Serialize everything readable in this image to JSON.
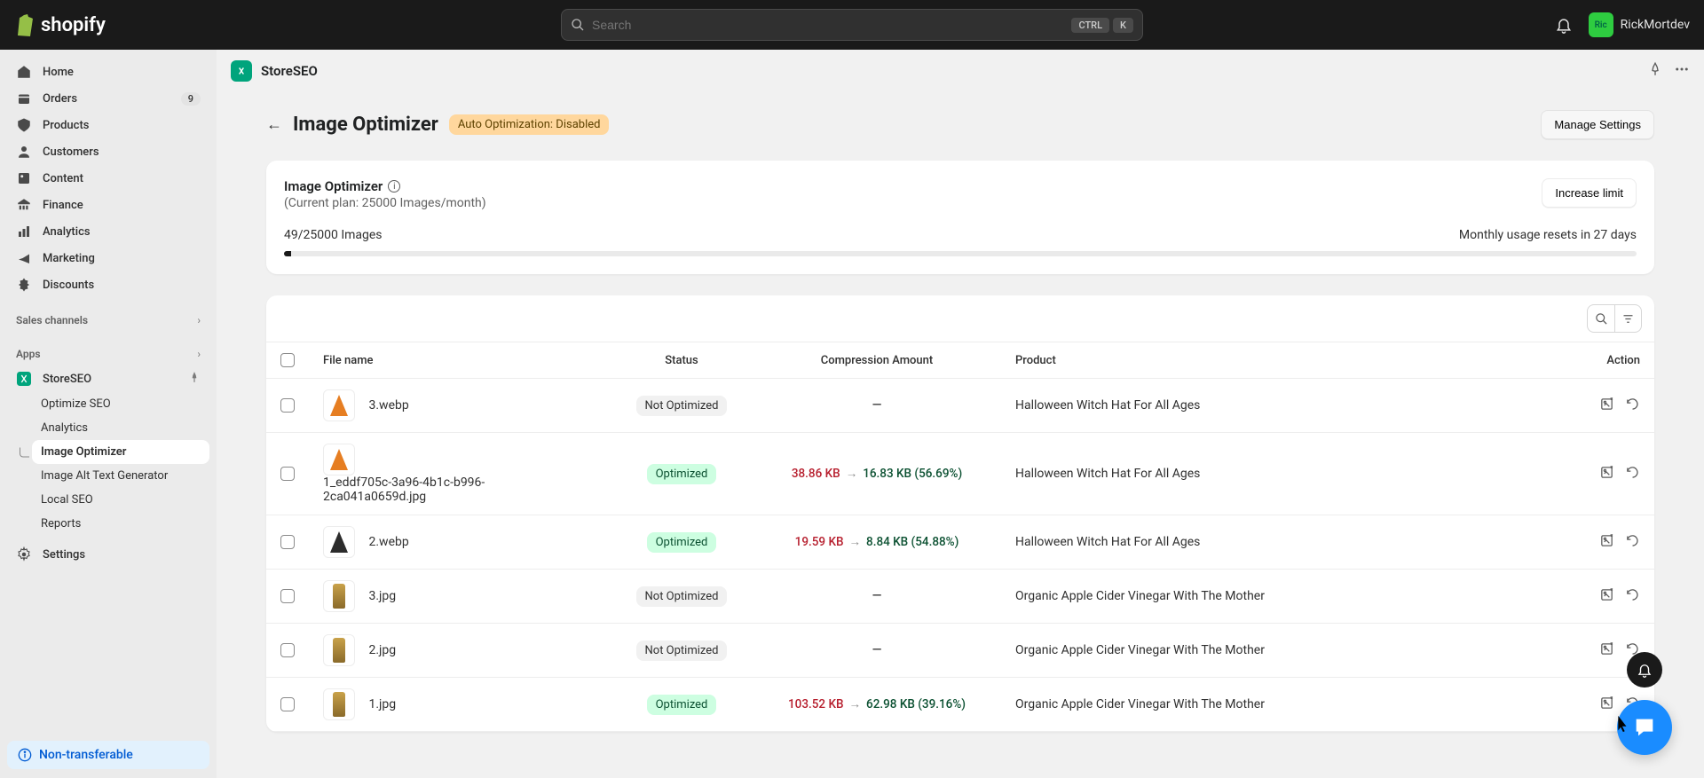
{
  "topbar": {
    "brand": "shopify",
    "search_placeholder": "Search",
    "kbd_ctrl": "CTRL",
    "kbd_k": "K",
    "username": "RickMortdev",
    "avatar_initials": "Ric"
  },
  "sidebar": {
    "items": [
      {
        "label": "Home",
        "icon": "home-icon"
      },
      {
        "label": "Orders",
        "icon": "orders-icon",
        "badge": "9"
      },
      {
        "label": "Products",
        "icon": "products-icon"
      },
      {
        "label": "Customers",
        "icon": "customers-icon"
      },
      {
        "label": "Content",
        "icon": "content-icon"
      },
      {
        "label": "Finance",
        "icon": "finance-icon"
      },
      {
        "label": "Analytics",
        "icon": "analytics-icon"
      },
      {
        "label": "Marketing",
        "icon": "marketing-icon"
      },
      {
        "label": "Discounts",
        "icon": "discounts-icon"
      }
    ],
    "section_sales": "Sales channels",
    "section_apps": "Apps",
    "app_label": "StoreSEO",
    "sub_items": [
      "Optimize SEO",
      "Analytics",
      "Image Optimizer",
      "Image Alt Text Generator",
      "Local SEO",
      "Reports"
    ],
    "settings_label": "Settings",
    "banner_text": "Non-transferable"
  },
  "appbar": {
    "name": "StoreSEO"
  },
  "page": {
    "title": "Image Optimizer",
    "badge": "Auto Optimization: Disabled",
    "manage_btn": "Manage Settings"
  },
  "usage_card": {
    "title": "Image Optimizer",
    "plan": "(Current plan: 25000 Images/month)",
    "increase_btn": "Increase limit",
    "usage_text": "49/25000 Images",
    "reset_text": "Monthly usage resets in 27 days"
  },
  "table": {
    "columns": {
      "filename": "File name",
      "status": "Status",
      "compression": "Compression Amount",
      "product": "Product",
      "action": "Action"
    },
    "status_optimized": "Optimized",
    "status_not_optimized": "Not Optimized",
    "rows": [
      {
        "file": "3.webp",
        "status": "not",
        "from": "",
        "to": "",
        "pct": "",
        "product": "Halloween Witch Hat For All Ages",
        "thumb": "hat-orange"
      },
      {
        "file": "1_eddf705c-3a96-4b1c-b996-2ca041a0659d.jpg",
        "status": "opt",
        "from": "38.86 KB",
        "to": "16.83 KB",
        "pct": "(56.69%)",
        "product": "Halloween Witch Hat For All Ages",
        "thumb": "hat-orange"
      },
      {
        "file": "2.webp",
        "status": "opt",
        "from": "19.59 KB",
        "to": "8.84 KB",
        "pct": "(54.88%)",
        "product": "Halloween Witch Hat For All Ages",
        "thumb": "hat-black"
      },
      {
        "file": "3.jpg",
        "status": "not",
        "from": "",
        "to": "",
        "pct": "",
        "product": "Organic Apple Cider Vinegar With The Mother",
        "thumb": "bottle"
      },
      {
        "file": "2.jpg",
        "status": "not",
        "from": "",
        "to": "",
        "pct": "",
        "product": "Organic Apple Cider Vinegar With The Mother",
        "thumb": "bottle"
      },
      {
        "file": "1.jpg",
        "status": "opt",
        "from": "103.52 KB",
        "to": "62.98 KB",
        "pct": "(39.16%)",
        "product": "Organic Apple Cider Vinegar With The Mother",
        "thumb": "bottle"
      }
    ]
  }
}
